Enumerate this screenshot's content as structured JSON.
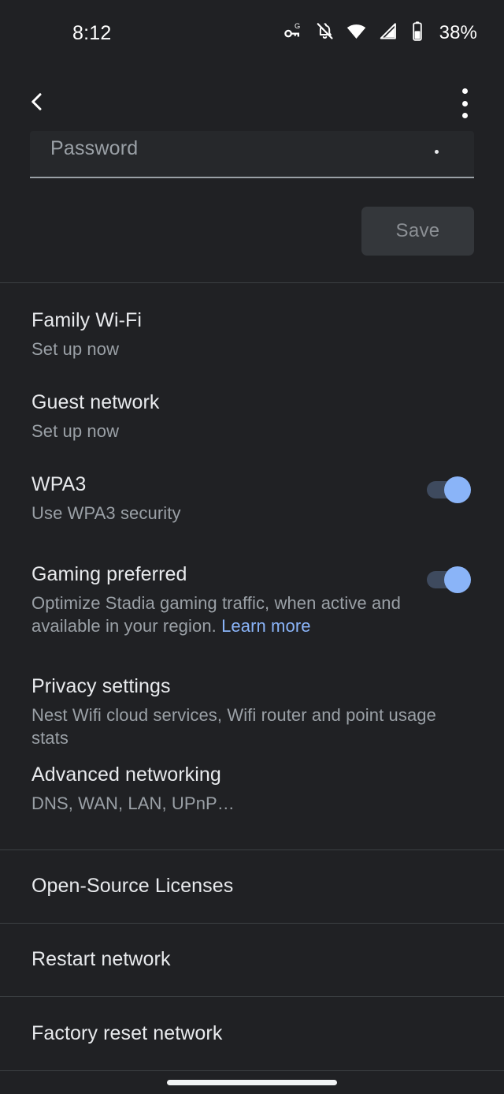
{
  "status_bar": {
    "time": "8:12",
    "battery_percent": "38%",
    "icons": [
      "vpn-key-g-icon",
      "notifications-off-icon",
      "wifi-icon",
      "cell-signal-icon",
      "battery-icon"
    ]
  },
  "app_bar": {
    "back_icon": "chevron-left-icon",
    "overflow_icon": "more-vert-icon"
  },
  "password_section": {
    "field_label": "Password",
    "field_value": "",
    "save_label": "Save"
  },
  "settings": [
    {
      "title": "Family Wi-Fi",
      "subtitle": "Set up now",
      "toggle": null
    },
    {
      "title": "Guest network",
      "subtitle": "Set up now",
      "toggle": null
    },
    {
      "title": "WPA3",
      "subtitle": "Use WPA3 security",
      "toggle": "on"
    },
    {
      "title": "Gaming preferred",
      "subtitle": "Optimize Stadia gaming traffic, when active and available in your region. ",
      "link": "Learn more",
      "toggle": "on"
    },
    {
      "title": "Privacy settings",
      "subtitle": "Nest Wifi cloud services, Wifi router and point usage stats",
      "toggle": null
    },
    {
      "title": "Advanced networking",
      "subtitle": "DNS, WAN, LAN, UPnP…",
      "toggle": null
    }
  ],
  "actions": [
    {
      "label": "Open-Source Licenses"
    },
    {
      "label": "Restart network"
    },
    {
      "label": "Factory reset network"
    }
  ],
  "colors": {
    "background": "#202124",
    "divider": "#3c4043",
    "primary_text": "#e8eaed",
    "secondary_text": "#9aa0a6",
    "accent": "#8ab4f8",
    "toggle_track": "#3e4a5e",
    "save_button_bg": "#34373b"
  }
}
